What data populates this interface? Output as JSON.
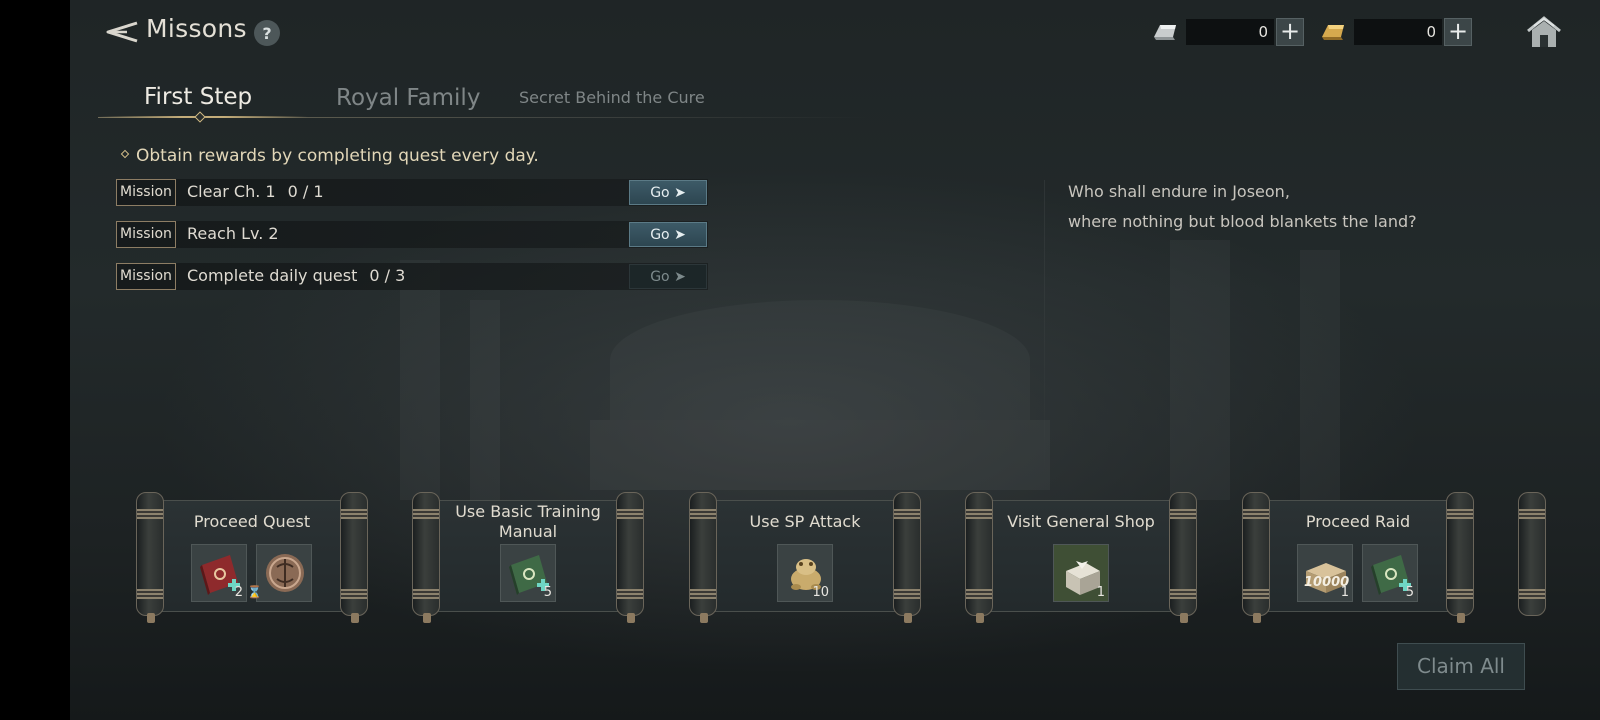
{
  "header": {
    "title": "Missons",
    "help": "?",
    "currencies": [
      {
        "icon": "silver-ingot-icon",
        "value": "0",
        "plus": "+"
      },
      {
        "icon": "gold-ingot-icon",
        "value": "0",
        "plus": "+"
      }
    ]
  },
  "tabs": [
    {
      "label": "First Step",
      "active": true
    },
    {
      "label": "Royal Family",
      "active": false
    },
    {
      "label": "Secret Behind the Cure",
      "active": false
    }
  ],
  "info": "Obtain rewards by completing quest every day.",
  "missions": [
    {
      "tag": "Mission",
      "text": "Clear Ch. 1",
      "progress": "0 / 1",
      "button": "Go",
      "enabled": true
    },
    {
      "tag": "Mission",
      "text": "Reach Lv. 2",
      "progress": "",
      "button": "Go",
      "enabled": true
    },
    {
      "tag": "Mission",
      "text": "Complete daily quest",
      "progress": "0 / 3",
      "button": "Go",
      "enabled": false
    }
  ],
  "story": {
    "line1": "Who shall endure in Joseon,",
    "line2": "where nothing but blood blankets the land?"
  },
  "cards": [
    {
      "title": "Proceed Quest",
      "rewards": [
        {
          "icon": "red-book-icon",
          "qty": "2"
        },
        {
          "icon": "bronze-coin-icon",
          "qty": ""
        }
      ]
    },
    {
      "title": "Use Basic Training Manual",
      "rewards": [
        {
          "icon": "green-book-icon",
          "qty": "5"
        }
      ]
    },
    {
      "title": "Use SP Attack",
      "rewards": [
        {
          "icon": "gold-toad-icon",
          "qty": "10"
        }
      ]
    },
    {
      "title": "Visit General Shop",
      "rewards": [
        {
          "icon": "gift-box-icon",
          "qty": "1"
        }
      ]
    },
    {
      "title": "Proceed Raid",
      "rewards": [
        {
          "icon": "money-bundle-icon",
          "qty": "1",
          "label": "10000"
        },
        {
          "icon": "green-book-icon",
          "qty": "5"
        }
      ]
    }
  ],
  "claim_all": "Claim All"
}
